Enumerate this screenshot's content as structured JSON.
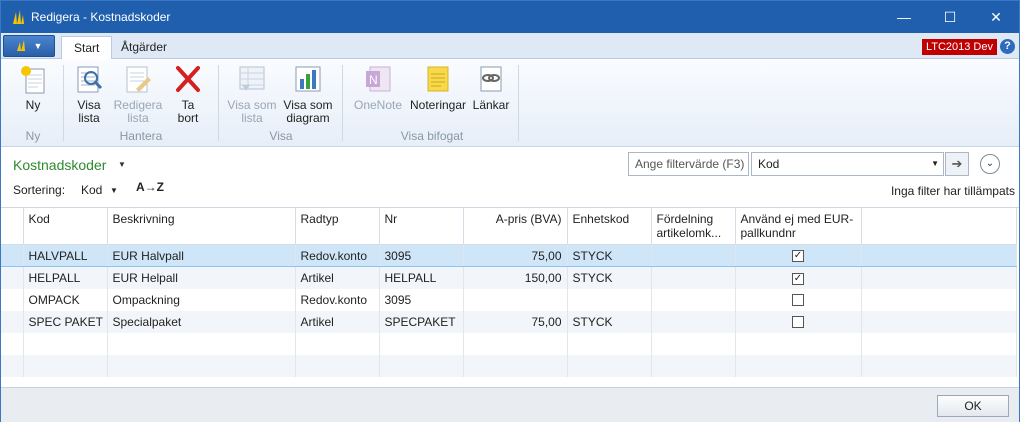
{
  "window": {
    "title": "Redigera - Kostnadskoder",
    "controls": [
      "—",
      "☐",
      "✕"
    ]
  },
  "ribbon_tabs": {
    "app_menu_icon": "dynamics-icon",
    "start": "Start",
    "atgarder": "Åtgärder",
    "badge": "LTC2013 Dev",
    "help": "?"
  },
  "ribbon": {
    "buttons": {
      "ny": "Ny",
      "visa_lista": "Visa lista",
      "redigera_lista": "Redigera lista",
      "ta_bort": "Ta bort",
      "visa_som_lista": "Visa som lista",
      "visa_som_diagram": "Visa som diagram",
      "onenote": "OneNote",
      "noteringar": "Noteringar",
      "lankar": "Länkar"
    },
    "groups": {
      "ny": "Ny",
      "hantera": "Hantera",
      "visa": "Visa",
      "visa_bifogat": "Visa bifogat"
    }
  },
  "page": {
    "title": "Kostnadskoder",
    "filter_placeholder": "Ange filtervärde (F3)",
    "filter_field": "Kod",
    "sort_label": "Sortering:",
    "sort_value": "Kod",
    "sort_dir": "A→Z",
    "no_filter": "Inga filter har tillämpats"
  },
  "table": {
    "headers": [
      "Kod",
      "Beskrivning",
      "Radtyp",
      "Nr",
      "A-pris (BVA)",
      "Enhetskod",
      "Fördelning artikelomk...",
      "Använd ej med EUR-pallkundnr"
    ],
    "rows": [
      {
        "kod": "HALVPALL",
        "beskrivning": "EUR Halvpall",
        "radtyp": "Redov.konto",
        "nr": "3095",
        "apris": "75,00",
        "enhet": "STYCK",
        "fordelning": "",
        "anvand": true
      },
      {
        "kod": "HELPALL",
        "beskrivning": "EUR Helpall",
        "radtyp": "Artikel",
        "nr": "HELPALL",
        "apris": "150,00",
        "enhet": "STYCK",
        "fordelning": "",
        "anvand": true
      },
      {
        "kod": "OMPACK",
        "beskrivning": "Ompackning",
        "radtyp": "Redov.konto",
        "nr": "3095",
        "apris": "",
        "enhet": "",
        "fordelning": "",
        "anvand": false
      },
      {
        "kod": "SPEC PAKET",
        "beskrivning": "Specialpaket",
        "radtyp": "Artikel",
        "nr": "SPECPAKET",
        "apris": "75,00",
        "enhet": "STYCK",
        "fordelning": "",
        "anvand": false
      }
    ]
  },
  "footer": {
    "ok": "OK"
  }
}
